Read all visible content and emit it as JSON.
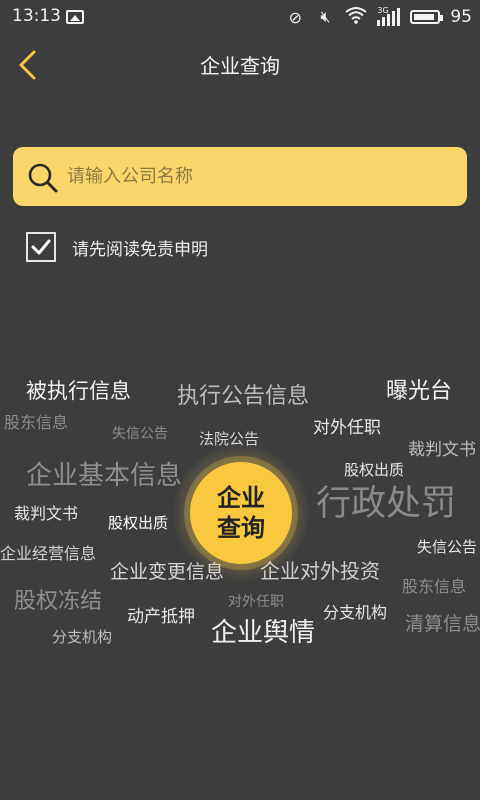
{
  "status_bar": {
    "time": "13:13",
    "network": "3G",
    "battery": "95"
  },
  "header": {
    "title": "企业查询"
  },
  "search": {
    "placeholder": "请输入公司名称",
    "value": ""
  },
  "agreement": {
    "label": "请先阅读免责申明",
    "checked": true
  },
  "center_button": {
    "line1": "企业",
    "line2": "查询"
  },
  "cloud": [
    "被执行信息",
    "执行公告信息",
    "曝光台",
    "股东信息",
    "失信公告",
    "法院公告",
    "对外任职",
    "裁判文书",
    "企业基本信息",
    "股权出质",
    "行政处罚",
    "裁判文书",
    "股权出质",
    "企业经营信息",
    "失信公告",
    "企业变更信息",
    "企业对外投资",
    "股东信息",
    "股权冻结",
    "动产抵押",
    "对外任职",
    "分支机构",
    "清算信息",
    "分支机构",
    "企业舆情"
  ],
  "colors": {
    "accent": "#fbd66a",
    "center": "#f8c93f",
    "background": "#3d3d3d"
  }
}
